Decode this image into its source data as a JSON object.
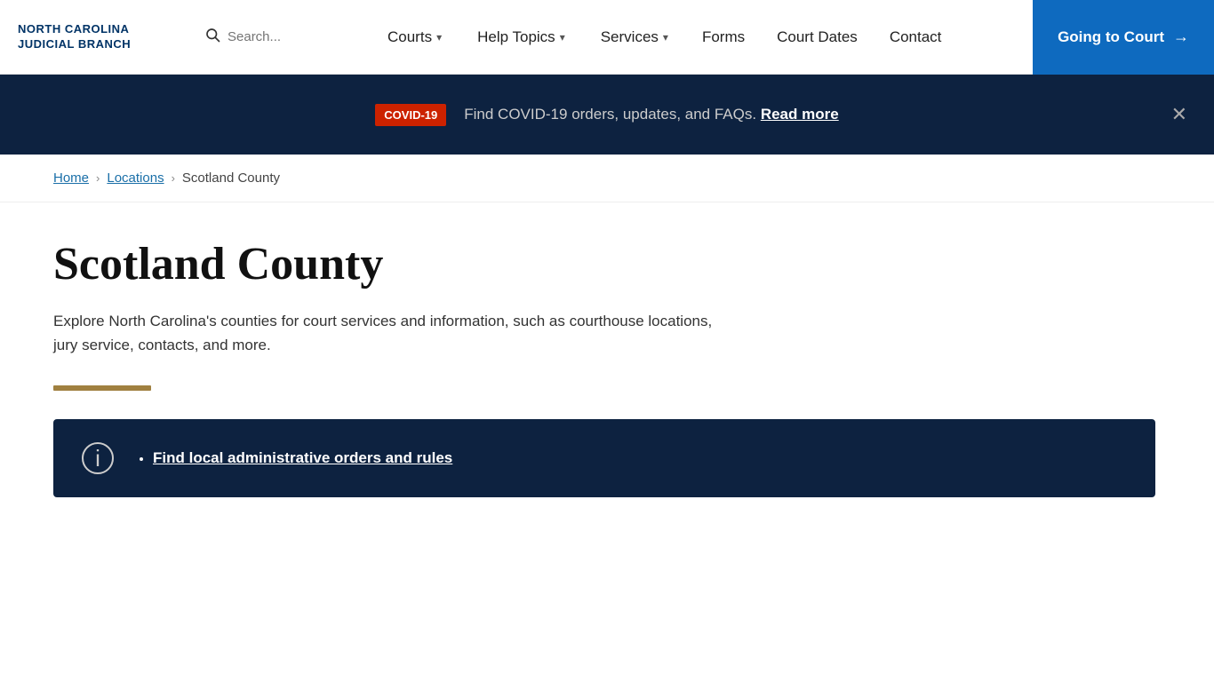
{
  "header": {
    "logo_line1": "NORTH CAROLINA",
    "logo_line2": "JUDICIAL BRANCH",
    "search_placeholder": "Search...",
    "nav_items": [
      {
        "label": "Courts",
        "has_dropdown": true
      },
      {
        "label": "Help Topics",
        "has_dropdown": true
      },
      {
        "label": "Services",
        "has_dropdown": true
      },
      {
        "label": "Forms",
        "has_dropdown": false
      },
      {
        "label": "Court Dates",
        "has_dropdown": false
      },
      {
        "label": "Contact",
        "has_dropdown": false
      }
    ],
    "cta_label": "Going to Court",
    "cta_arrow": "→"
  },
  "covid_banner": {
    "badge_text": "COVID-19",
    "message": "Find COVID-19 orders, updates, and FAQs.",
    "read_more_label": "Read more"
  },
  "breadcrumb": {
    "home_label": "Home",
    "locations_label": "Locations",
    "current_label": "Scotland County"
  },
  "main": {
    "page_title": "Scotland County",
    "description": "Explore North Carolina's counties for court services and information, such as courthouse locations, jury service, contacts, and more.",
    "info_box_link_label": "Find local administrative orders and rules"
  }
}
